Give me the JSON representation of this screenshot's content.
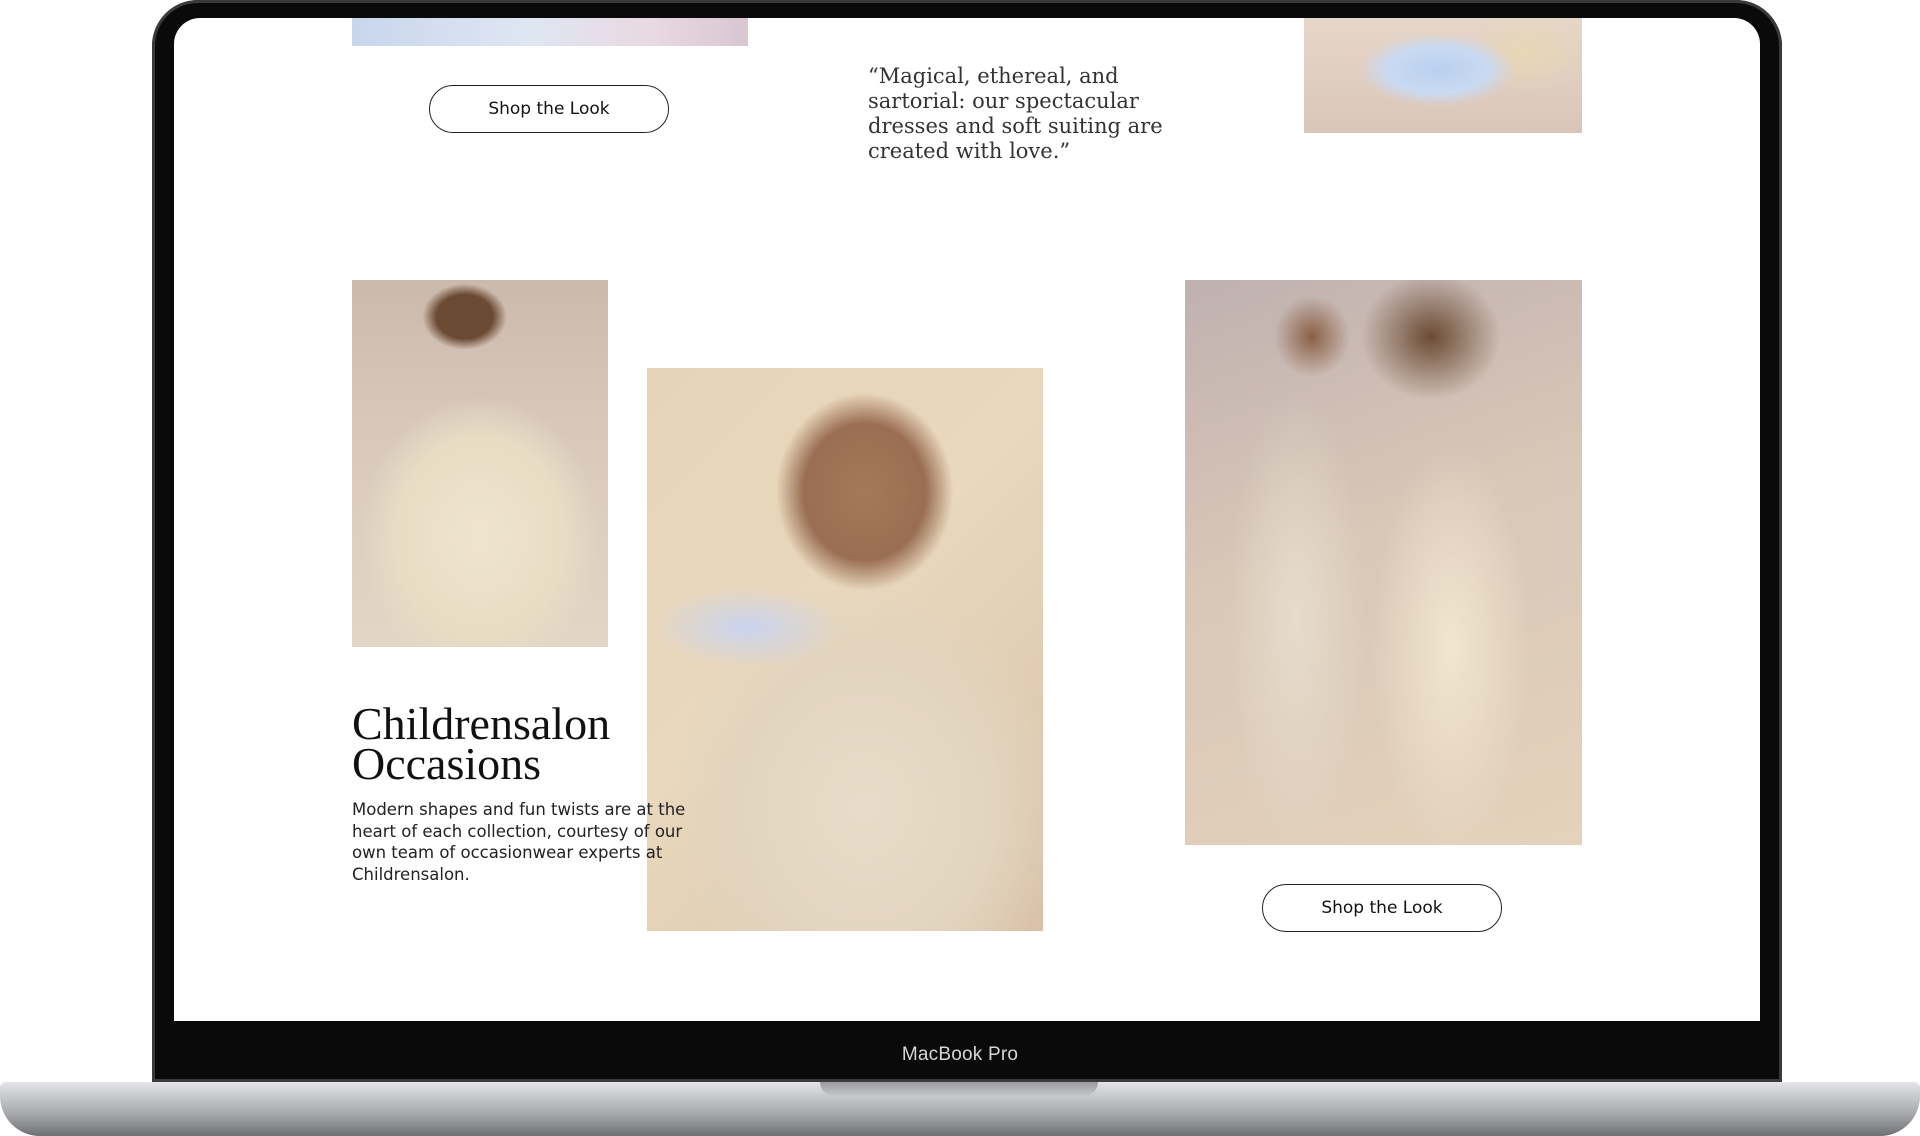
{
  "device": {
    "model_label": "MacBook Pro"
  },
  "page": {
    "top_section": {
      "shop_button_label": "Shop the Look",
      "quote": "“Magical, ethereal, and sartorial: our spectacular dresses and soft suiting are created with love.”"
    },
    "occasions": {
      "title_line1": "Childrensalon",
      "title_line2": "Occasions",
      "description": "Modern shapes and fun twists are at the heart of each collection, courtesy of our own team of occasionwear experts at Childrensalon.",
      "shop_button_label": "Shop the Look"
    }
  }
}
